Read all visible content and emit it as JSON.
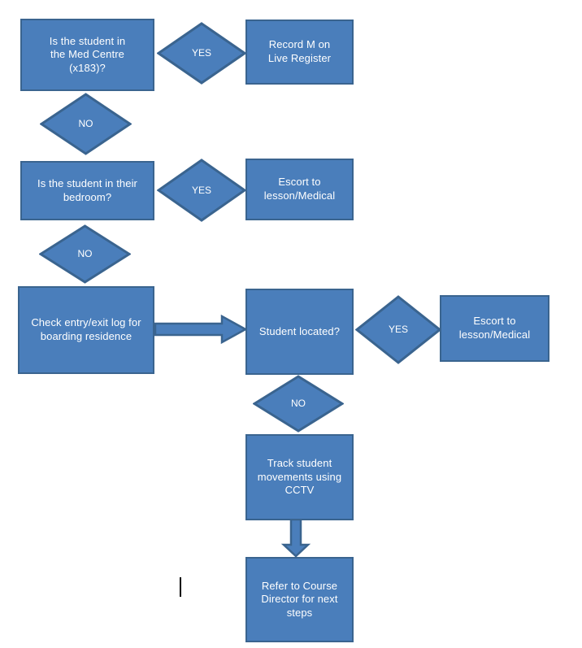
{
  "diagram": {
    "title": "Student location escalation flowchart",
    "colors": {
      "node_fill": "#4a7ebb",
      "node_border": "#3a648f",
      "node_text": "#ffffff",
      "background": "#ffffff",
      "arrow_fill": "#4a7ebb",
      "arrow_border": "#3a648f"
    },
    "nodes": [
      {
        "id": "med-centre",
        "shape": "process",
        "text": "Is the student in\nthe Med Centre\n(x183)?"
      },
      {
        "id": "yes-1",
        "shape": "decision",
        "text": "YES"
      },
      {
        "id": "record-m",
        "shape": "process",
        "text": "Record M on\nLive Register"
      },
      {
        "id": "no-1",
        "shape": "decision",
        "text": "NO"
      },
      {
        "id": "bedroom",
        "shape": "process",
        "text": "Is the student in their\nbedroom?"
      },
      {
        "id": "yes-2",
        "shape": "decision",
        "text": "YES"
      },
      {
        "id": "escort-1",
        "shape": "process",
        "text": "Escort to\nlesson/Medical"
      },
      {
        "id": "no-2",
        "shape": "decision",
        "text": "NO"
      },
      {
        "id": "check-log",
        "shape": "process",
        "text": "Check entry/exit log for\nboarding residence"
      },
      {
        "id": "student-located",
        "shape": "process",
        "text": "Student located?"
      },
      {
        "id": "yes-3",
        "shape": "decision",
        "text": "YES"
      },
      {
        "id": "escort-2",
        "shape": "process",
        "text": "Escort to\nlesson/Medical"
      },
      {
        "id": "no-3",
        "shape": "decision",
        "text": "NO"
      },
      {
        "id": "cctv",
        "shape": "process",
        "text": "Track student\nmovements using\nCCTV"
      },
      {
        "id": "refer",
        "shape": "process",
        "text": "Refer to Course\nDirector for next\nsteps"
      }
    ],
    "arrows": [
      {
        "id": "check-log-to-student-located",
        "direction": "right"
      },
      {
        "id": "cctv-to-refer",
        "direction": "down"
      }
    ],
    "caret": {
      "id": "text-caret",
      "visible": true
    }
  }
}
